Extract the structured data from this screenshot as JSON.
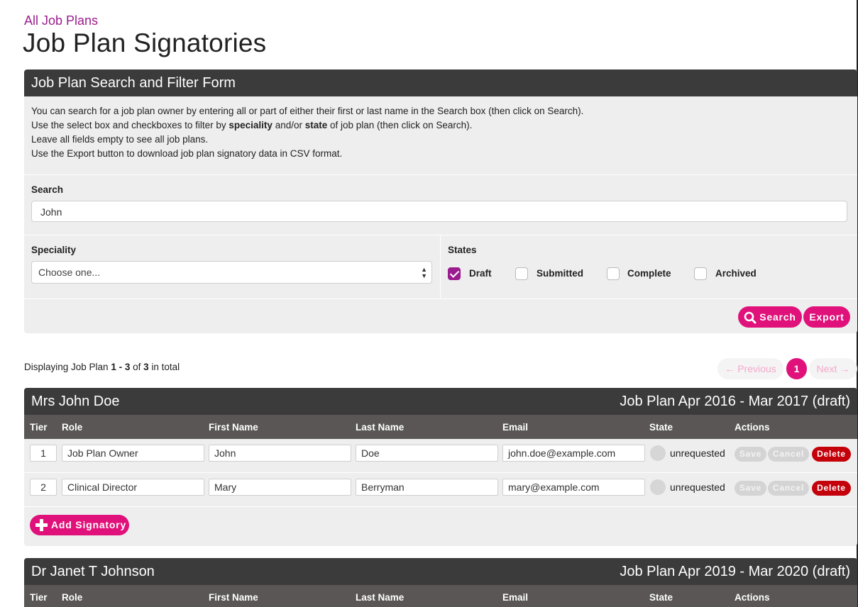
{
  "breadcrumb": {
    "back_link": "All Job Plans"
  },
  "page": {
    "title": "Job Plan Signatories"
  },
  "filter_form": {
    "title": "Job Plan Search and Filter Form",
    "intro_line1": "You can search for a job plan owner by entering all or part of either their first or last name in the Search box (then click on Search).",
    "intro_line2_pre": "Use the select box and checkboxes to filter by ",
    "intro_line2_b1": "speciality",
    "intro_line2_mid": " and/or ",
    "intro_line2_b2": "state",
    "intro_line2_post": " of job plan (then click on Search).",
    "intro_line3": "Leave all fields empty to see all job plans.",
    "intro_line4": "Use the Export button to download job plan signatory data in CSV format.",
    "search_label": "Search",
    "search_value": "John",
    "speciality_label": "Speciality",
    "speciality_selected": "Choose one...",
    "states_label": "States",
    "states": [
      {
        "label": "Draft",
        "checked": true
      },
      {
        "label": "Submitted",
        "checked": false
      },
      {
        "label": "Complete",
        "checked": false
      },
      {
        "label": "Archived",
        "checked": false
      }
    ],
    "search_button": "Search",
    "export_button": "Export"
  },
  "results": {
    "prefix": "Displaying Job Plan ",
    "range": "1 - 3",
    "of": " of ",
    "total": "3",
    "suffix": " in total"
  },
  "pagination": {
    "previous": "← Previous",
    "current": "1",
    "next": "Next →"
  },
  "columns": {
    "tier": "Tier",
    "role": "Role",
    "first_name": "First Name",
    "last_name": "Last Name",
    "email": "Email",
    "state": "State",
    "actions": "Actions"
  },
  "row_actions": {
    "save": "Save",
    "cancel": "Cancel",
    "delete": "Delete"
  },
  "add_signatory": "Add Signatory",
  "job_plans": [
    {
      "owner": "Mrs John Doe",
      "period": "Job Plan Apr 2016 - Mar 2017 (draft)",
      "signatories": [
        {
          "tier": "1",
          "role": "Job Plan Owner",
          "first_name": "John",
          "last_name": "Doe",
          "email": "john.doe@example.com",
          "state": "unrequested"
        },
        {
          "tier": "2",
          "role": "Clinical Director",
          "first_name": "Mary",
          "last_name": "Berryman",
          "email": "mary@example.com",
          "state": "unrequested"
        }
      ]
    },
    {
      "owner": "Dr Janet T Johnson",
      "period": "Job Plan Apr 2019 - Mar 2020 (draft)",
      "signatories": []
    }
  ],
  "colors": {
    "accent_purple": "#9b1c8e",
    "accent_pink": "#e0117a",
    "header_dark": "#3c3b3b",
    "delete_red": "#c4000a"
  }
}
